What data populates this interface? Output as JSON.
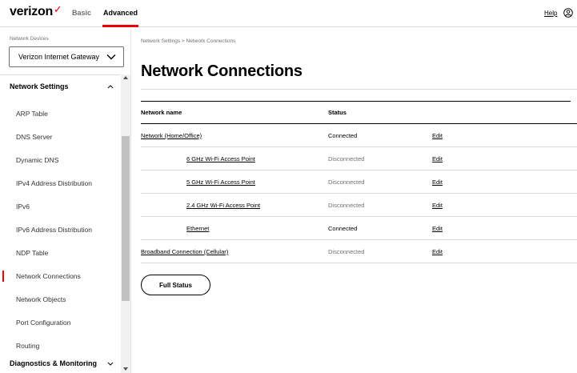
{
  "header": {
    "brand": "verizon",
    "tabs": [
      {
        "label": "Basic"
      },
      {
        "label": "Advanced"
      }
    ],
    "help_label": "Help",
    "user_icon": "user-circle-icon",
    "accent_color": "#ee0000"
  },
  "sidebar": {
    "devices_label": "Network Devices",
    "device_select_value": "Verizon Internet Gateway",
    "section_title": "Network Settings",
    "items": [
      {
        "label": "ARP Table"
      },
      {
        "label": "DNS Server"
      },
      {
        "label": "Dynamic DNS"
      },
      {
        "label": "IPv4 Address Distribution"
      },
      {
        "label": "IPv6"
      },
      {
        "label": "IPv6 Address Distribution"
      },
      {
        "label": "NDP Table"
      },
      {
        "label": "Network Connections"
      },
      {
        "label": "Network Objects"
      },
      {
        "label": "Port Configuration"
      },
      {
        "label": "Routing"
      }
    ],
    "active_item": "Network Connections",
    "next_section_title": "Diagnostics & Monitoring"
  },
  "main": {
    "breadcrumb": "Network Settings  >  Network Connections",
    "title": "Network Connections",
    "table": {
      "headers": {
        "name": "Network name",
        "status": "Status"
      },
      "rows": [
        {
          "name": "Network (Home/Office)",
          "status": "Connected",
          "edit": "Edit"
        },
        {
          "name": "6 GHz Wi-Fi Access Point",
          "status": "Disconnected",
          "edit": "Edit"
        },
        {
          "name": "5 GHz Wi-Fi Access Point",
          "status": "Disconnected",
          "edit": "Edit"
        },
        {
          "name": "2.4 GHz Wi-Fi Access Point",
          "status": "Disconnected",
          "edit": "Edit"
        },
        {
          "name": "Ethernet",
          "status": "Connected",
          "edit": "Edit"
        },
        {
          "name": "Broadband Connection (Cellular)",
          "status": "Disconnected",
          "edit": "Edit"
        }
      ]
    },
    "full_status_label": "Full Status"
  }
}
